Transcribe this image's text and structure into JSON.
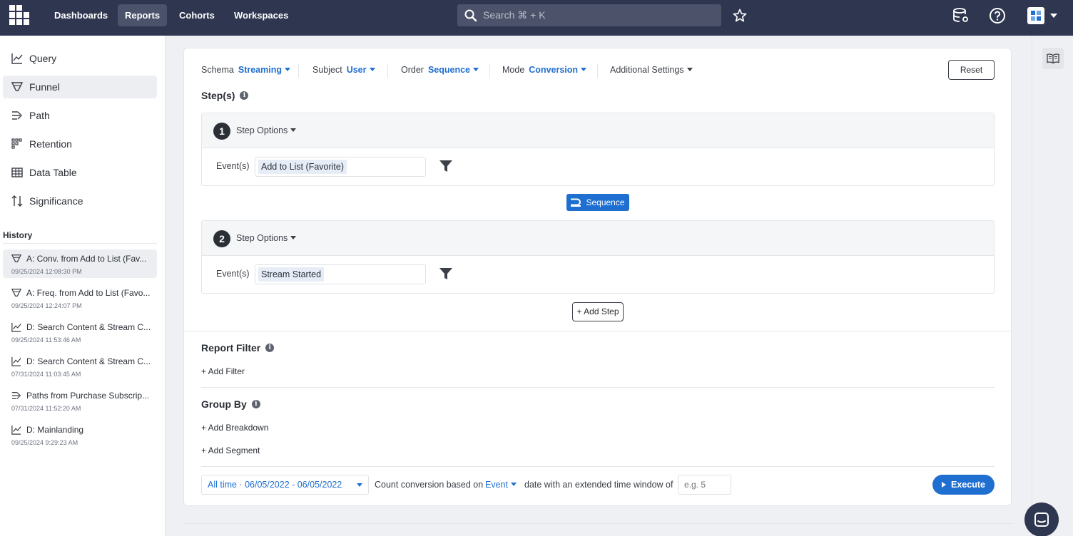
{
  "topnav": {
    "links": [
      "Dashboards",
      "Reports",
      "Cohorts",
      "Workspaces"
    ],
    "search_placeholder": "Search ⌘ + K"
  },
  "sidebar": {
    "items": [
      {
        "label": "Query",
        "icon": "line-chart-icon"
      },
      {
        "label": "Funnel",
        "icon": "funnel-icon"
      },
      {
        "label": "Path",
        "icon": "path-icon"
      },
      {
        "label": "Retention",
        "icon": "retention-icon"
      },
      {
        "label": "Data Table",
        "icon": "table-icon"
      },
      {
        "label": "Significance",
        "icon": "significance-icon"
      }
    ],
    "history_title": "History",
    "history": [
      {
        "title": "A: Conv. from Add to List (Fav...",
        "date": "09/25/2024 12:08:30 PM",
        "icon": "funnel-icon"
      },
      {
        "title": "A: Freq. from Add to List (Favo...",
        "date": "09/25/2024 12:24:07 PM",
        "icon": "funnel-icon"
      },
      {
        "title": "D: Search Content & Stream C...",
        "date": "09/25/2024 11:53:46 AM",
        "icon": "line-chart-icon"
      },
      {
        "title": "D: Search Content & Stream C...",
        "date": "07/31/2024 11:03:45 AM",
        "icon": "line-chart-icon"
      },
      {
        "title": "Paths from Purchase Subscrip...",
        "date": "07/31/2024 11:52:20 AM",
        "icon": "path-icon"
      },
      {
        "title": "D: Mainlanding",
        "date": "09/25/2024 9:29:23 AM",
        "icon": "line-chart-icon"
      }
    ]
  },
  "controls": {
    "schema_label": "Schema",
    "schema_value": "Streaming",
    "subject_label": "Subject",
    "subject_value": "User",
    "order_label": "Order",
    "order_value": "Sequence",
    "mode_label": "Mode",
    "mode_value": "Conversion",
    "additional": "Additional Settings",
    "reset": "Reset"
  },
  "steps_title": "Step(s)",
  "steps": [
    {
      "number": "1",
      "options": "Step Options",
      "events_label": "Event(s)",
      "event": "Add to List (Favorite)"
    },
    {
      "number": "2",
      "options": "Step Options",
      "events_label": "Event(s)",
      "event": "Stream Started"
    }
  ],
  "sequence_label": "Sequence",
  "add_step": "+ Add Step",
  "report_filter": {
    "title": "Report Filter",
    "add": "+ Add Filter"
  },
  "group_by": {
    "title": "Group By",
    "add_breakdown": "+ Add Breakdown",
    "add_segment": "+ Add Segment"
  },
  "footer": {
    "date_range": "All time · 06/05/2022 - 06/05/2022",
    "count_text": "Count conversion based on",
    "count_value": "Event",
    "window_text": "date with an extended time window of",
    "window_placeholder": "e.g. 5",
    "execute": "Execute"
  },
  "colors": {
    "accent": "#1f6fd1",
    "topbar": "#2f3650"
  }
}
